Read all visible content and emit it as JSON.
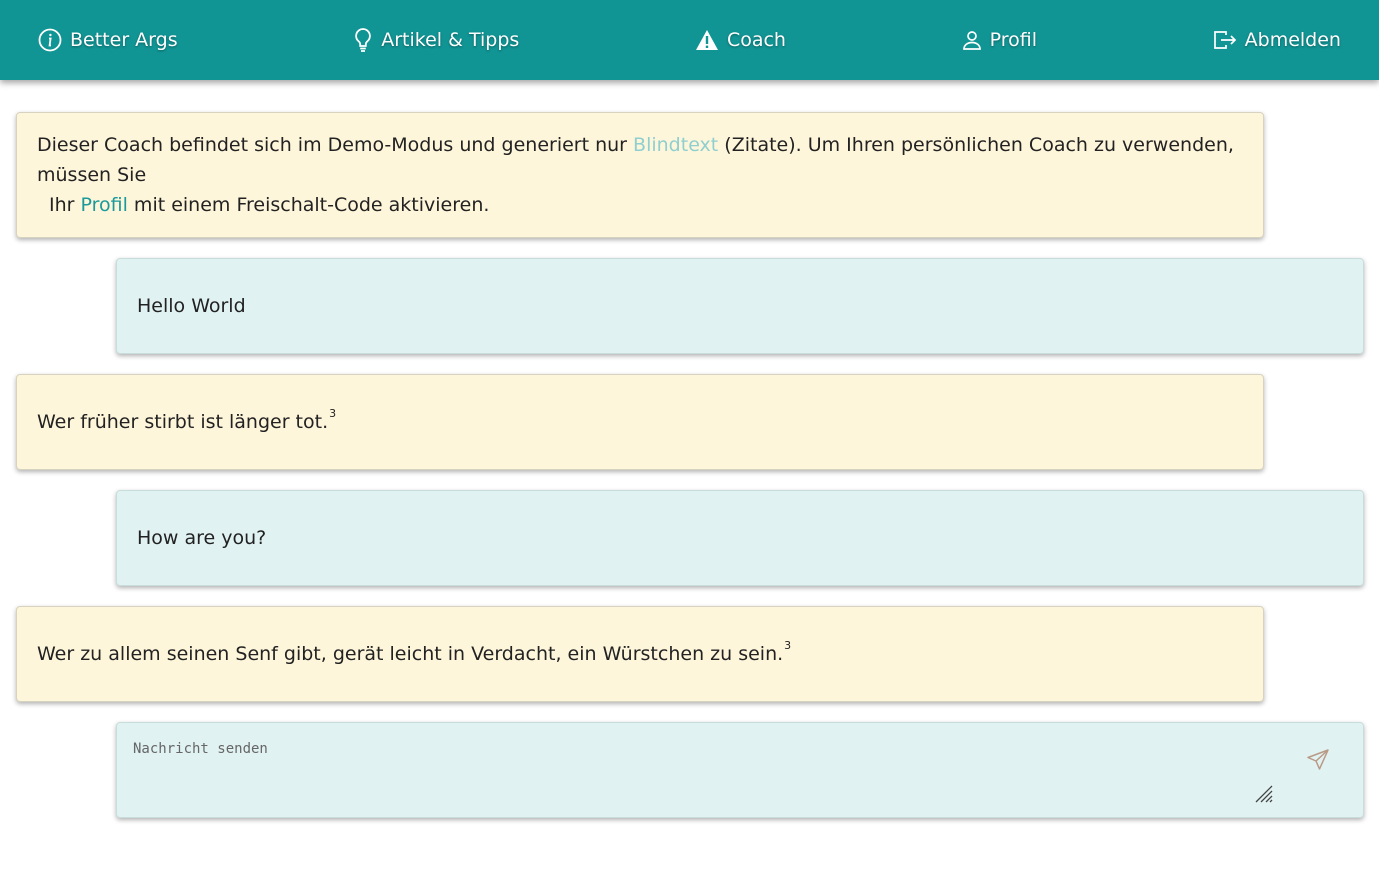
{
  "nav": {
    "brand": "Better Args",
    "articles": "Artikel & Tipps",
    "coach": "Coach",
    "profile": "Profil",
    "logout": "Abmelden"
  },
  "demo_notice": {
    "part1": "Dieser Coach befindet sich im Demo-Modus und generiert nur ",
    "link_blindtext": "Blindtext",
    "part2": " (Zitate). Um Ihren persönlichen Coach zu verwenden, müssen Sie",
    "part3": "Ihr ",
    "link_profile": "Profil",
    "part4": " mit einem Freischalt-Code aktivieren."
  },
  "messages": [
    {
      "role": "user",
      "text": "Hello World"
    },
    {
      "role": "coach",
      "text": "Wer früher stirbt ist länger tot.",
      "sup": "3"
    },
    {
      "role": "user",
      "text": "How are you?"
    },
    {
      "role": "coach",
      "text": "Wer zu allem seinen Senf gibt, gerät leicht in Verdacht, ein Würstchen zu sein.",
      "sup": "3"
    }
  ],
  "composer": {
    "placeholder": "Nachricht senden",
    "value": ""
  },
  "icons": {
    "brand": "info-circle-icon",
    "articles": "lightbulb-icon",
    "coach": "warning-triangle-icon",
    "profile": "person-icon",
    "logout": "logout-icon",
    "send": "send-icon"
  },
  "colors": {
    "navbar": "#119494",
    "coach_bubble": "#fef6db",
    "user_bubble": "#e1f2f2"
  }
}
